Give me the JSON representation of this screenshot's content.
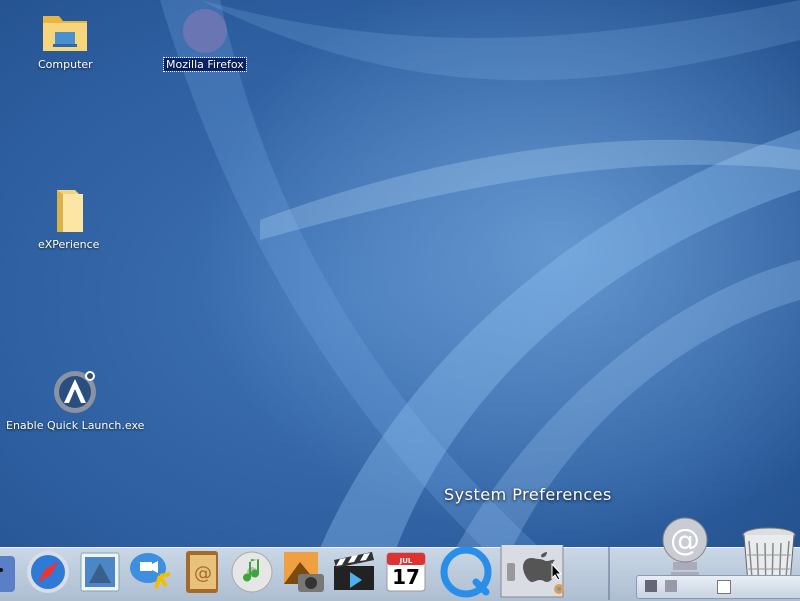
{
  "desktop": {
    "icons": [
      {
        "label": "Computer"
      },
      {
        "label": "Mozilla Firefox"
      },
      {
        "label": "eXPerience"
      },
      {
        "label": "Enable Quick Launch.exe"
      }
    ]
  },
  "tooltip": {
    "text": "System Preferences"
  },
  "dock": {
    "calendar_month": "JUL",
    "calendar_day": "17",
    "items": [
      "finder-icon",
      "safari-icon",
      "mail-icon",
      "ichat-icon",
      "address-book-icon",
      "itunes-icon",
      "iphoto-icon",
      "imovie-icon",
      "ical-icon",
      "quicktime-icon",
      "system-preferences-icon",
      "internet-connect-icon",
      "trash-icon"
    ]
  },
  "colors": {
    "desktop": "#2d5e9f",
    "dock": "#c9d7e6",
    "selection": "#0a246a"
  }
}
